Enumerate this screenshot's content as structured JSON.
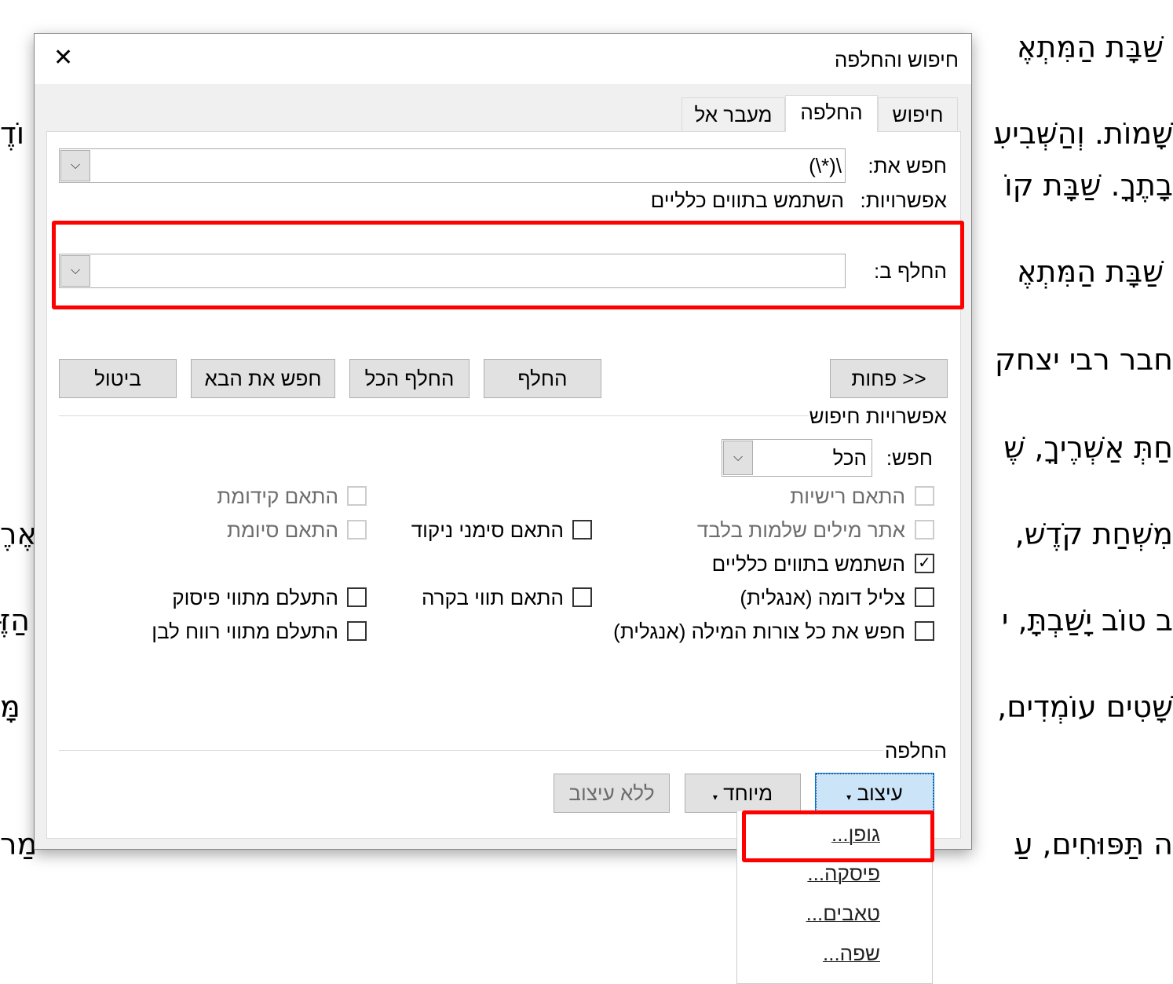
{
  "document": {
    "right_fragments": [
      "שַׁבָּת הַמִּתְאֶ",
      "שָׁמוֹת. וְהַשְּׁבִיעִ",
      "בָתֶךָ. שַׁבָּת קוֹ",
      "שַׁבָּת הַמִּתְאֶ",
      "חבר רבי יצחק",
      "חַתְּ אַשְׁרֶיךָ, שֶׁ",
      "מִשְׁחַת קֹדֶשׁ, ",
      "ב טוֹב יָשַׁבְתָּ, י",
      "שָׁטִים עוֹמְדִים,",
      "ה תַּפּוּחִים, עַ"
    ],
    "left_fragments": [
      "וֹדֶ",
      "אֶרֶ",
      "הַזֶּ",
      "מָּ",
      "מַר"
    ]
  },
  "dialog": {
    "title": "חיפוש והחלפה",
    "close_icon": "close-icon",
    "tabs": [
      {
        "label": "חיפוש"
      },
      {
        "label": "החלפה",
        "active": true
      },
      {
        "label": "מעבר אל"
      }
    ],
    "find_label": "חפש את:",
    "find_value": "\\(*\\)",
    "options_label": "אפשרויות:",
    "options_value": "השתמש בתווים כלליים",
    "replace_label": "החלף ב:",
    "replace_value": "",
    "buttons": {
      "less": "<< פחות",
      "replace": "החלף",
      "replace_all": "החלף הכל",
      "find_next": "חפש את הבא",
      "cancel": "ביטול"
    },
    "search_options_title": "אפשרויות חיפוש",
    "search_label": "חפש:",
    "search_value": "הכל",
    "checkboxes": [
      {
        "label": "התאם רישיות",
        "checked": false,
        "enabled": false
      },
      {
        "label": "התאם קידומת",
        "checked": false,
        "enabled": false
      },
      {
        "label": "אתר מילים שלמות בלבד",
        "checked": false,
        "enabled": false
      },
      {
        "label": "התאם סימני ניקוד",
        "checked": false,
        "enabled": true
      },
      {
        "label": "התאם סיומת",
        "checked": false,
        "enabled": false
      },
      {
        "label": "השתמש בתווים כלליים",
        "checked": true,
        "enabled": true
      },
      {
        "label": "צליל דומה (אנגלית)",
        "checked": false,
        "enabled": true
      },
      {
        "label": "התאם תווי בקרה",
        "checked": false,
        "enabled": true
      },
      {
        "label": "התעלם מתווי פיסוק",
        "checked": false,
        "enabled": true
      },
      {
        "label": "חפש את כל צורות המילה (אנגלית)",
        "checked": false,
        "enabled": true
      },
      {
        "label": "התעלם מתווי רווח לבן",
        "checked": false,
        "enabled": true
      }
    ],
    "replace_section_title": "החלפה",
    "format_button": "עיצוב",
    "special_button": "מיוחד",
    "no_format_button": "ללא עיצוב",
    "format_menu": [
      "גופן...",
      "פיסקה...",
      "טאבים...",
      "שפה..."
    ]
  },
  "colors": {
    "highlight": "#ff0000",
    "focused_button": "#cce4f7"
  }
}
